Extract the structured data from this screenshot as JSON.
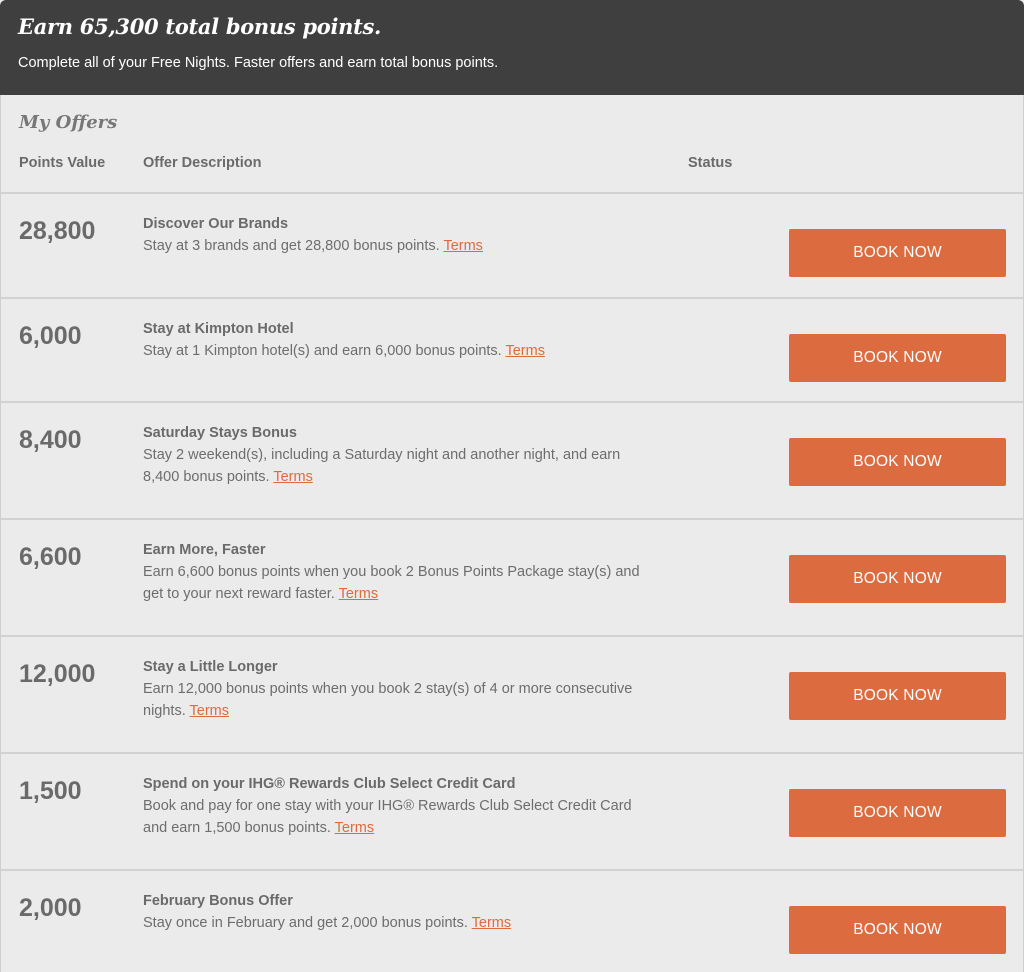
{
  "header": {
    "title": "Earn 65,300 total bonus points.",
    "subtitle": "Complete all of your Free Nights. Faster offers and earn total bonus points."
  },
  "panel": {
    "title": "My Offers",
    "columns": {
      "points": "Points Value",
      "description": "Offer Description",
      "status": "Status"
    }
  },
  "book_label": "BOOK NOW",
  "terms_label": "Terms",
  "offers": [
    {
      "points": "28,800",
      "title": "Discover Our Brands",
      "text": "Stay at 3 brands and get 28,800 bonus points."
    },
    {
      "points": "6,000",
      "title": "Stay at Kimpton Hotel",
      "text": "Stay at 1 Kimpton hotel(s) and earn 6,000 bonus points."
    },
    {
      "points": "8,400",
      "title": "Saturday Stays Bonus",
      "text": "Stay 2 weekend(s), including a Saturday night and another night, and earn 8,400 bonus points."
    },
    {
      "points": "6,600",
      "title": "Earn More, Faster",
      "text": "Earn 6,600 bonus points when you book 2 Bonus Points Package stay(s) and get to your next reward faster."
    },
    {
      "points": "12,000",
      "title": "Stay a Little Longer",
      "text": "Earn 12,000 bonus points when you book 2 stay(s) of 4 or more consecutive nights."
    },
    {
      "points": "1,500",
      "title": "Spend on your IHG® Rewards Club Select Credit Card",
      "text": "Book and pay for one stay with your IHG® Rewards Club Select Credit Card and earn 1,500 bonus points."
    },
    {
      "points": "2,000",
      "title": "February Bonus Offer",
      "text": "Stay once in February and get 2,000 bonus points."
    }
  ]
}
